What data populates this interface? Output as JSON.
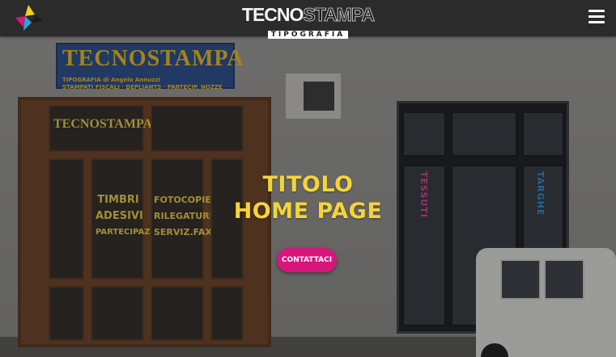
{
  "header": {
    "brand_main_light": "TECNO",
    "brand_main_dark": "STAMPA",
    "brand_sub": "TIPOGRAFIA",
    "logo_icon": "cmyk-triangles-icon",
    "menu_icon": "hamburger-menu-icon"
  },
  "hero": {
    "title_line1": "TITOLO",
    "title_line2": "HOME PAGE",
    "cta_label": "CONTATTACI",
    "title_color": "#f4d43a",
    "cta_color": "#d8157c"
  },
  "photo": {
    "sign_title": "TECNOSTAMPA",
    "sign_sub": "TIPOGRAFIA   di Angelo Annuzzi",
    "sign_line": "STAMPATI FISCALI · DEPLIANTS · PARTECIP. NOZZE",
    "window_left_col": [
      "TIMBRI",
      "ADESIVI",
      "PARTECIPAZ."
    ],
    "window_right_col": [
      "FOTOCOPIE",
      "RILEGATURE",
      "SERVIZ.FAX"
    ],
    "door_sign": "TECNOSTAMPA",
    "vertical_left": "TESSUTI",
    "vertical_right": "TARGHE"
  }
}
